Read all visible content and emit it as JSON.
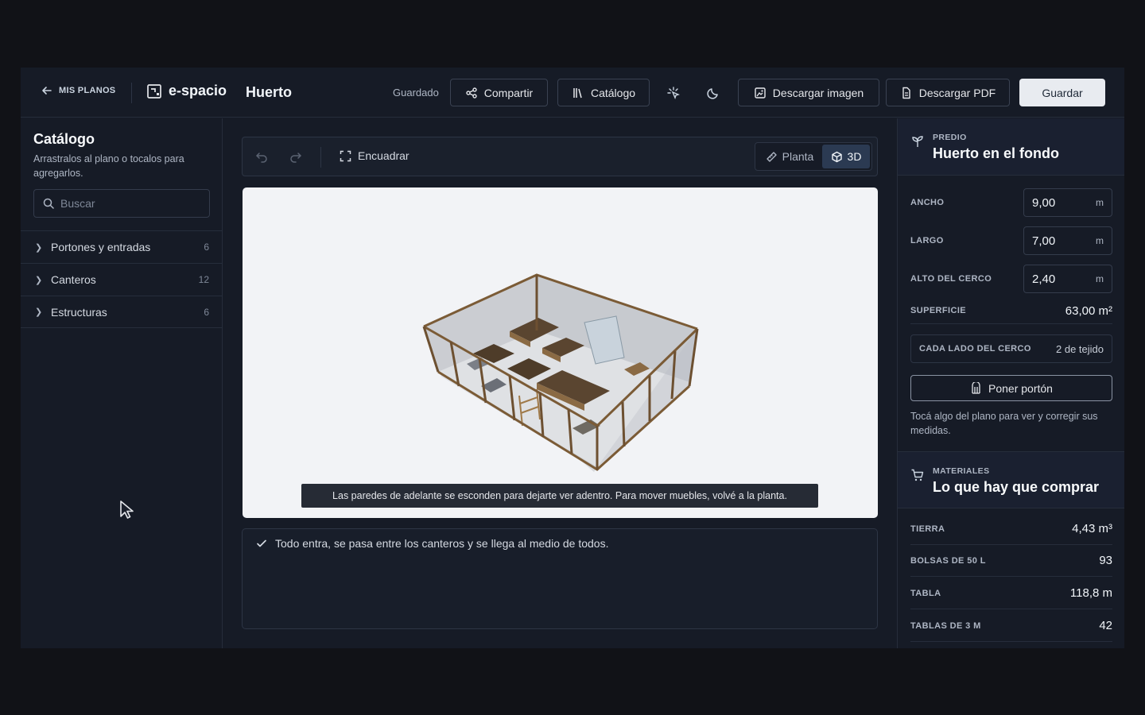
{
  "header": {
    "back_label": "MIS PLANOS",
    "brand": "e-spacio",
    "project_name": "Huerto",
    "save_status": "Guardado",
    "share_label": "Compartir",
    "catalog_label": "Catálogo",
    "download_image_label": "Descargar imagen",
    "download_pdf_label": "Descargar PDF",
    "save_label": "Guardar"
  },
  "sidebar": {
    "title": "Catálogo",
    "description": "Arrastralos al plano o tocalos para agregarlos.",
    "search_placeholder": "Buscar",
    "categories": [
      {
        "label": "Portones y entradas",
        "count": "6"
      },
      {
        "label": "Canteros",
        "count": "12"
      },
      {
        "label": "Estructuras",
        "count": "6"
      }
    ]
  },
  "toolbar": {
    "fit_label": "Encuadrar",
    "view_plan_label": "Planta",
    "view_3d_label": "3D",
    "active_view": "3D"
  },
  "canvas": {
    "tooltip": "Las paredes de adelante se esconden para dejarte ver adentro. Para mover muebles, volvé a la planta."
  },
  "status": {
    "message": "Todo entra, se pasa entre los canteros y se llega al medio de todos."
  },
  "lot": {
    "kicker": "PREDIO",
    "title": "Huerto en el fondo",
    "width_label": "ANCHO",
    "width_value": "9,00",
    "length_label": "LARGO",
    "length_value": "7,00",
    "fence_height_label": "ALTO DEL CERCO",
    "fence_height_value": "2,40",
    "unit": "m",
    "area_label": "SUPERFICIE",
    "area_value": "63,00 m²",
    "fence_sides_label": "CADA LADO DEL CERCO",
    "fence_sides_value": "2 de tejido",
    "gate_button_label": "Poner portón",
    "hint": "Tocá algo del plano para ver y corregir sus medidas."
  },
  "materials": {
    "kicker": "MATERIALES",
    "title": "Lo que hay que comprar",
    "items": [
      {
        "label": "TIERRA",
        "value": "4,43 m³"
      },
      {
        "label": "BOLSAS DE 50 L",
        "value": "93"
      },
      {
        "label": "TABLA",
        "value": "118,8 m"
      },
      {
        "label": "TABLAS DE 3 M",
        "value": "42"
      }
    ]
  },
  "colors": {
    "background": "#111217",
    "panel": "#161b26",
    "accent_active": "#2b3a52",
    "canvas": "#f2f3f6"
  }
}
